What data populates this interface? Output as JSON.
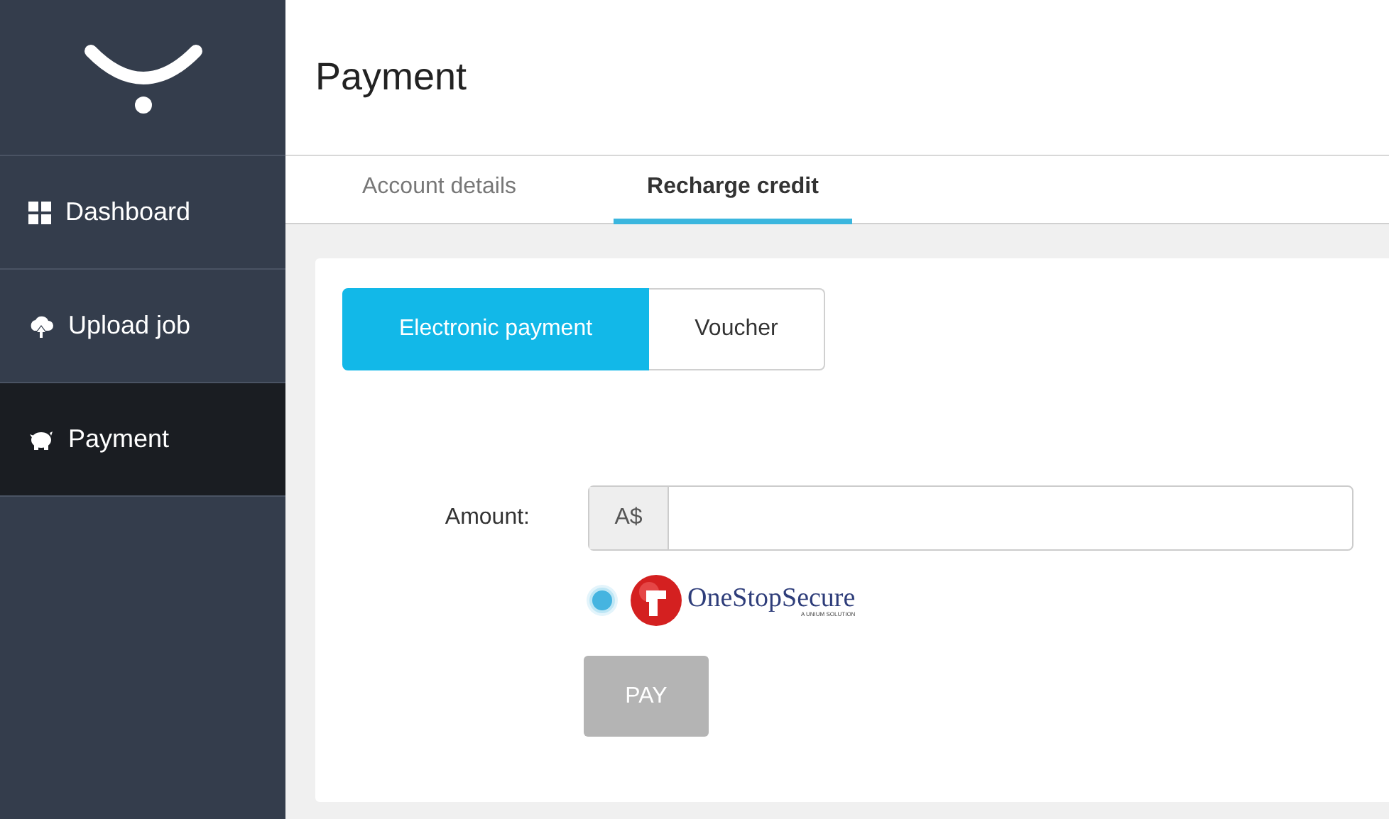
{
  "sidebar": {
    "items": [
      {
        "label": "Dashboard",
        "kind": "grid",
        "selected": false
      },
      {
        "label": "Upload job",
        "kind": "upload",
        "selected": false
      },
      {
        "label": "Payment",
        "kind": "piggy",
        "selected": true
      }
    ]
  },
  "header": {
    "title": "Payment"
  },
  "tabs": [
    {
      "label": "Account details",
      "selected": false
    },
    {
      "label": "Recharge credit",
      "selected": true
    }
  ],
  "payment_modes": [
    {
      "label": "Electronic payment",
      "selected": true
    },
    {
      "label": "Voucher",
      "selected": false
    }
  ],
  "amount": {
    "label": "Amount:",
    "prefix": "A$"
  },
  "providers": [
    {
      "name": "OneStopSecure",
      "tagline": "A UNIUM SOLUTION",
      "selected": true
    }
  ],
  "pay_button": {
    "label": "PAY",
    "disabled": true
  }
}
